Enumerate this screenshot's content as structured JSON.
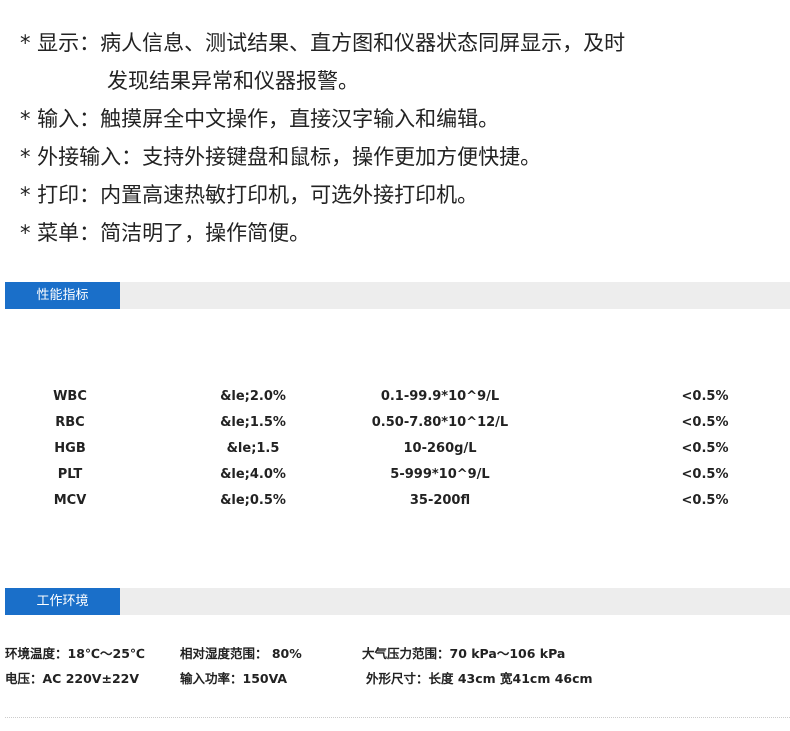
{
  "features": [
    {
      "line1": "* 显示：病人信息、测试结果、直方图和仪器状态同屏显示，及时",
      "line2": "发现结果异常和仪器报警。"
    },
    {
      "line1": "* 输入：触摸屏全中文操作，直接汉字输入和编辑。"
    },
    {
      "line1": "* 外接输入：支持外接键盘和鼠标，操作更加方便快捷。"
    },
    {
      "line1": "* 打印：内置高速热敏打印机，可选外接打印机。"
    },
    {
      "line1": "* 菜单：简洁明了，操作简便。"
    }
  ],
  "sections": {
    "performance": "性能指标",
    "environment": "工作环境"
  },
  "specs": [
    {
      "name": "WBC",
      "precision": "&le;2.0%",
      "range": "0.1-99.9*10^9/L",
      "cv": "<0.5%"
    },
    {
      "name": "RBC",
      "precision": "&le;1.5%",
      "range": "0.50-7.80*10^12/L",
      "cv": "<0.5%"
    },
    {
      "name": "HGB",
      "precision": "&le;1.5",
      "range": "10-260g/L",
      "cv": "<0.5%"
    },
    {
      "name": "PLT",
      "precision": "&le;4.0%",
      "range": "5-999*10^9/L",
      "cv": "<0.5%"
    },
    {
      "name": "MCV",
      "precision": "&le;0.5%",
      "range": "35-200fl",
      "cv": "<0.5%"
    }
  ],
  "environment": {
    "temp": "环境温度：18℃～25℃",
    "humidity": "相对湿度范围： 80%",
    "pressure": "大气压力范围：70 kPa～106 kPa",
    "power": "电压：AC 220V±22V",
    "input_power": "输入功率：150VA",
    "size": "外形尺寸：长度 43cm   宽41cm   46cm"
  }
}
